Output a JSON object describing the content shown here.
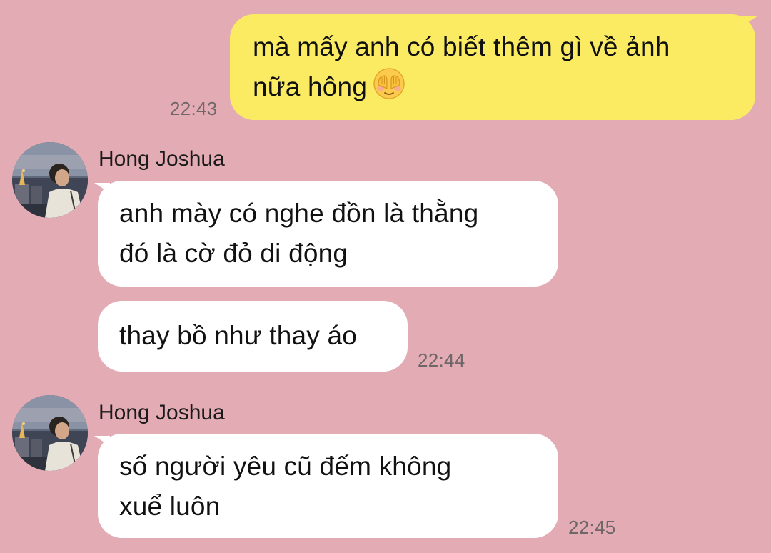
{
  "messages": [
    {
      "direction": "sent",
      "lines": [
        "mà mấy anh có biết thêm gì về ảnh",
        "nữa hông"
      ],
      "emoji": "face-with-hand-over-mouth-icon",
      "time": "22:43"
    },
    {
      "direction": "received",
      "sender": "Hong Joshua",
      "lines": [
        "anh mày có nghe đồn là thằng",
        "đó là cờ đỏ di động"
      ]
    },
    {
      "direction": "received",
      "lines": [
        "thay bồ như thay áo"
      ],
      "time": "22:44"
    },
    {
      "direction": "received",
      "sender": "Hong Joshua",
      "lines": [
        "số người yêu cũ đếm không",
        "xuể luôn"
      ],
      "time": "22:45"
    }
  ],
  "colors": {
    "background": "#e3abb3",
    "sent_bubble": "#fbeb63",
    "received_bubble": "#ffffff",
    "timestamp": "#6f6668"
  }
}
